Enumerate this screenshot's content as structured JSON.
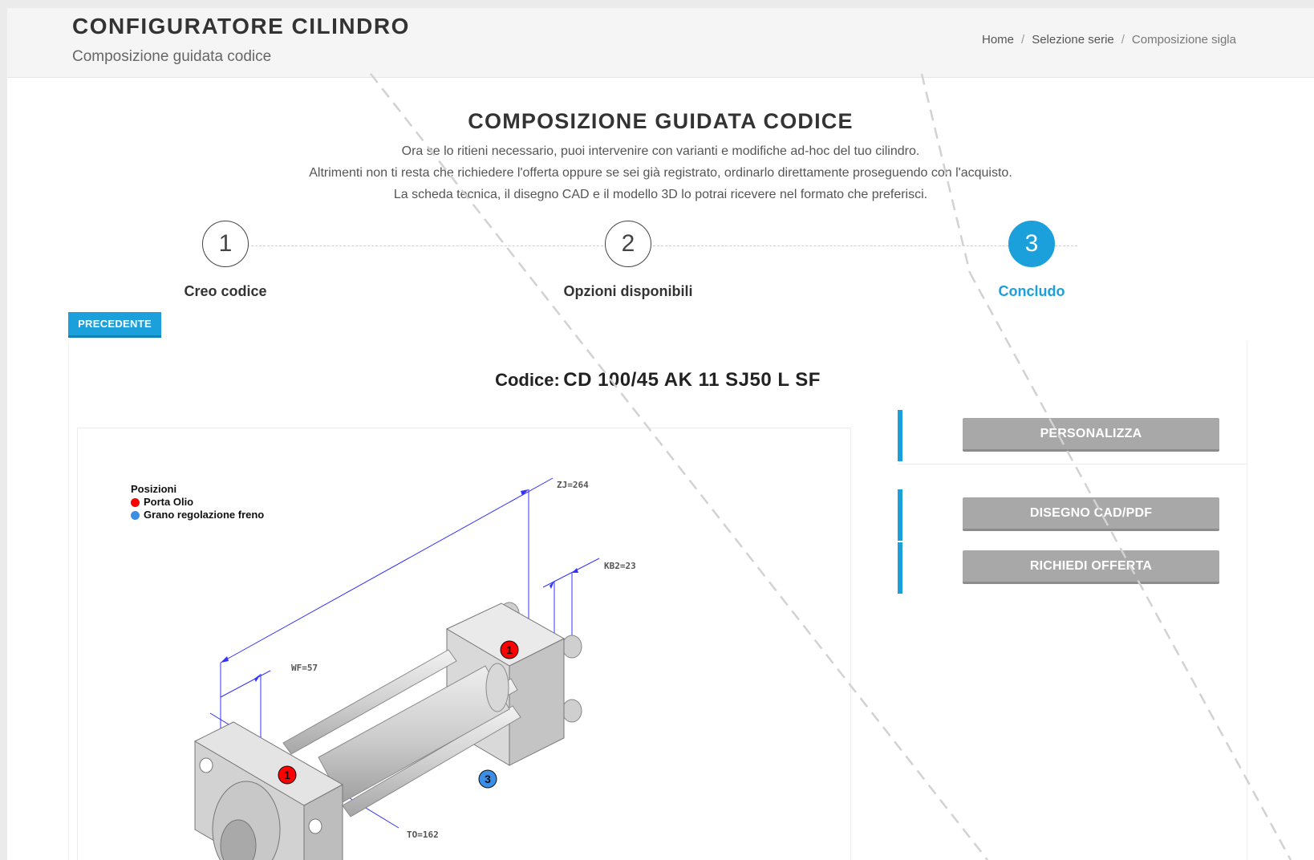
{
  "header": {
    "title": "CONFIGURATORE CILINDRO",
    "subtitle": "Composizione guidata codice",
    "breadcrumb": {
      "home": "Home",
      "separator": "/",
      "series": "Selezione serie",
      "current": "Composizione sigla"
    }
  },
  "main": {
    "heading": "COMPOSIZIONE GUIDATA CODICE",
    "intro": [
      "Ora se lo ritieni necessario, puoi intervenire con varianti e modifiche ad-hoc del tuo cilindro.",
      "Altrimenti non ti resta che richiedere l'offerta oppure se sei già registrato, ordinarlo direttamente proseguendo con l'acquisto.",
      "La scheda tecnica, il disegno CAD e il modello 3D lo potrai ricevere nel formato che preferisci."
    ]
  },
  "steps": [
    {
      "number": "1",
      "label": "Creo codice",
      "active": false
    },
    {
      "number": "2",
      "label": "Opzioni disponibili",
      "active": false
    },
    {
      "number": "3",
      "label": "Concludo",
      "active": true
    }
  ],
  "buttons": {
    "previous": "PRECEDENTE",
    "customize": "PERSONALIZZA",
    "cad_pdf": "DISEGNO CAD/PDF",
    "request_offer": "RICHIEDI OFFERTA"
  },
  "code": {
    "label": "Codice:",
    "value": "CD 100/45 AK 11 SJ50 L SF"
  },
  "drawing": {
    "legend_title": "Posizioni",
    "legend_items": [
      {
        "label": "Porta Olio",
        "color": "#ff0000"
      },
      {
        "label": "Grano regolazione freno",
        "color": "#3a8ee6"
      }
    ],
    "dimensions": {
      "zj": "ZJ=264",
      "kb2": "KB2=23",
      "wf": "WF=57",
      "to": "TO=162"
    },
    "markers": {
      "oil_port": "1",
      "brake": "3"
    }
  },
  "colors": {
    "accent": "#1ba0dc",
    "button_gray": "#a8a8a8",
    "dimension_line": "#3333ff"
  }
}
